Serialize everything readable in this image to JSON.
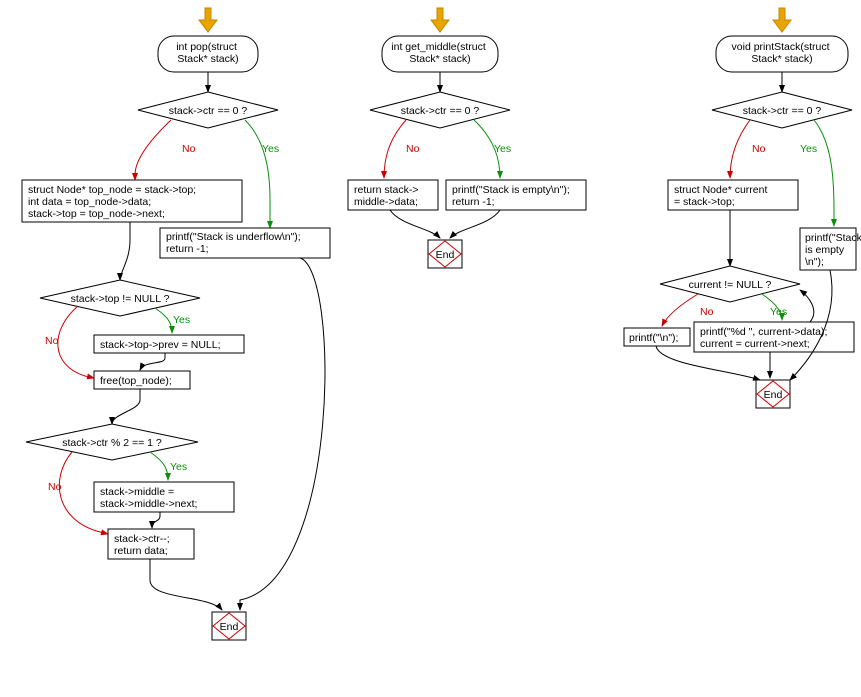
{
  "labels": {
    "yes": "Yes",
    "no": "No",
    "end": "End"
  },
  "flowcharts": [
    {
      "id": "pop",
      "signature": "int pop(struct\nStack* stack)",
      "nodes": {
        "cond1": "stack->ctr == 0 ?",
        "box_underflow": "printf(\"Stack is underflow\\n\");\nreturn -1;",
        "box_assign": "struct Node* top_node = stack->top;\nint data = top_node->data;\nstack->top = top_node->next;",
        "cond_null": "stack->top != NULL ?",
        "box_prevnull": "stack->top->prev = NULL;",
        "box_free": "free(top_node);",
        "cond_mod": "stack->ctr % 2 == 1 ?",
        "box_mid": "stack->middle =\nstack->middle->next;",
        "box_ret": "stack->ctr--;\nreturn data;"
      }
    },
    {
      "id": "get_middle",
      "signature": "int get_middle(struct\nStack* stack)",
      "nodes": {
        "cond1": "stack->ctr == 0 ?",
        "box_empty": "printf(\"Stack is empty\\n\");\nreturn -1;",
        "box_ret": "return stack->\nmiddle->data;"
      }
    },
    {
      "id": "print",
      "signature": "void printStack(struct\nStack* stack)",
      "nodes": {
        "cond1": "stack->ctr == 0 ?",
        "box_empty": "printf(\"Stack\nis empty\\n\");",
        "box_cur": "struct Node* current\n= stack->top;",
        "cond_cur": "current != NULL ?",
        "box_loop": "printf(\"%d \", current->data);\ncurrent = current->next;",
        "box_newline": "printf(\"\\n\");"
      }
    }
  ],
  "chart_data": [
    {
      "type": "flowchart",
      "title": "int pop(struct Stack* stack)",
      "nodes": [
        {
          "id": "start",
          "kind": "entry"
        },
        {
          "id": "cond_ctr0",
          "kind": "decision",
          "text": "stack->ctr == 0 ?"
        },
        {
          "id": "underflow",
          "kind": "process",
          "text": "printf(\"Stack is underflow\\n\"); return -1;"
        },
        {
          "id": "assign_top",
          "kind": "process",
          "text": "struct Node* top_node = stack->top; int data = top_node->data; stack->top = top_node->next;"
        },
        {
          "id": "cond_topnull",
          "kind": "decision",
          "text": "stack->top != NULL ?"
        },
        {
          "id": "set_prevnull",
          "kind": "process",
          "text": "stack->top->prev = NULL;"
        },
        {
          "id": "free_top",
          "kind": "process",
          "text": "free(top_node);"
        },
        {
          "id": "cond_mod",
          "kind": "decision",
          "text": "stack->ctr % 2 == 1 ?"
        },
        {
          "id": "advance_mid",
          "kind": "process",
          "text": "stack->middle = stack->middle->next;"
        },
        {
          "id": "dec_return",
          "kind": "process",
          "text": "stack->ctr--; return data;"
        },
        {
          "id": "end",
          "kind": "terminal",
          "text": "End"
        }
      ],
      "edges": [
        {
          "from": "start",
          "to": "cond_ctr0"
        },
        {
          "from": "cond_ctr0",
          "to": "underflow",
          "label": "Yes"
        },
        {
          "from": "cond_ctr0",
          "to": "assign_top",
          "label": "No"
        },
        {
          "from": "underflow",
          "to": "end"
        },
        {
          "from": "assign_top",
          "to": "cond_topnull"
        },
        {
          "from": "cond_topnull",
          "to": "set_prevnull",
          "label": "Yes"
        },
        {
          "from": "cond_topnull",
          "to": "free_top",
          "label": "No"
        },
        {
          "from": "set_prevnull",
          "to": "free_top"
        },
        {
          "from": "free_top",
          "to": "cond_mod"
        },
        {
          "from": "cond_mod",
          "to": "advance_mid",
          "label": "Yes"
        },
        {
          "from": "cond_mod",
          "to": "dec_return",
          "label": "No"
        },
        {
          "from": "advance_mid",
          "to": "dec_return"
        },
        {
          "from": "dec_return",
          "to": "end"
        }
      ]
    },
    {
      "type": "flowchart",
      "title": "int get_middle(struct Stack* stack)",
      "nodes": [
        {
          "id": "start",
          "kind": "entry"
        },
        {
          "id": "cond_ctr0",
          "kind": "decision",
          "text": "stack->ctr == 0 ?"
        },
        {
          "id": "empty",
          "kind": "process",
          "text": "printf(\"Stack is empty\\n\"); return -1;"
        },
        {
          "id": "ret_mid",
          "kind": "process",
          "text": "return stack->middle->data;"
        },
        {
          "id": "end",
          "kind": "terminal",
          "text": "End"
        }
      ],
      "edges": [
        {
          "from": "start",
          "to": "cond_ctr0"
        },
        {
          "from": "cond_ctr0",
          "to": "empty",
          "label": "Yes"
        },
        {
          "from": "cond_ctr0",
          "to": "ret_mid",
          "label": "No"
        },
        {
          "from": "empty",
          "to": "end"
        },
        {
          "from": "ret_mid",
          "to": "end"
        }
      ]
    },
    {
      "type": "flowchart",
      "title": "void printStack(struct Stack* stack)",
      "nodes": [
        {
          "id": "start",
          "kind": "entry"
        },
        {
          "id": "cond_ctr0",
          "kind": "decision",
          "text": "stack->ctr == 0 ?"
        },
        {
          "id": "empty",
          "kind": "process",
          "text": "printf(\"Stack is empty\\n\");"
        },
        {
          "id": "cur_assign",
          "kind": "process",
          "text": "struct Node* current = stack->top;"
        },
        {
          "id": "cond_cur",
          "kind": "decision",
          "text": "current != NULL ?"
        },
        {
          "id": "loop_body",
          "kind": "process",
          "text": "printf(\"%d \", current->data); current = current->next;"
        },
        {
          "id": "print_nl",
          "kind": "process",
          "text": "printf(\"\\n\");"
        },
        {
          "id": "end",
          "kind": "terminal",
          "text": "End"
        }
      ],
      "edges": [
        {
          "from": "start",
          "to": "cond_ctr0"
        },
        {
          "from": "cond_ctr0",
          "to": "empty",
          "label": "Yes"
        },
        {
          "from": "cond_ctr0",
          "to": "cur_assign",
          "label": "No"
        },
        {
          "from": "cur_assign",
          "to": "cond_cur"
        },
        {
          "from": "cond_cur",
          "to": "loop_body",
          "label": "Yes"
        },
        {
          "from": "loop_body",
          "to": "cond_cur"
        },
        {
          "from": "cond_cur",
          "to": "print_nl",
          "label": "No"
        },
        {
          "from": "print_nl",
          "to": "end"
        },
        {
          "from": "empty",
          "to": "end"
        }
      ]
    }
  ]
}
